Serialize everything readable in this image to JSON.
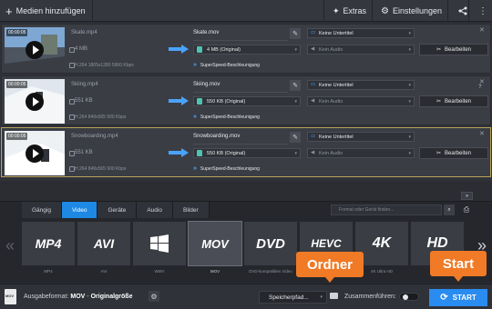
{
  "toolbar": {
    "add_media": "Medien hinzufügen",
    "extras": "Extras",
    "settings": "Einstellungen"
  },
  "files": [
    {
      "timestamp": "00:00:05",
      "source_name": "Skate.mp4",
      "source_size": "4 MB",
      "source_info": "H.264 1805x1280 5900 Kbps",
      "output_name": "Skate.mov",
      "output_size": "4 MB (Original)",
      "speed_label": "SuperSpeed-Beschleunigung",
      "subtitles": "Keine Untertitel",
      "audio": "Kein Audio",
      "edit_label": "Bearbeiten"
    },
    {
      "timestamp": "00:00:05",
      "source_name": "Skiing.mp4",
      "source_size": "551 KB",
      "source_info": "H.264 849x565 900 Kbps",
      "output_name": "Skiing.mov",
      "output_size": "550 KB (Original)",
      "speed_label": "SuperSpeed-Beschleunigung",
      "subtitles": "Keine Untertitel",
      "audio": "Kein Audio",
      "edit_label": "Bearbeiten"
    },
    {
      "timestamp": "00:00:05",
      "source_name": "Snowboarding.mp4",
      "source_size": "551 KB",
      "source_info": "H.264 849x565 900 Kbps",
      "output_name": "Snowboarding.mov",
      "output_size": "550 KB (Original)",
      "speed_label": "SuperSpeed-Beschleunigung",
      "subtitles": "Keine Untertitel",
      "audio": "Kein Audio",
      "edit_label": "Bearbeiten"
    }
  ],
  "tabs": [
    "Gängig",
    "Video",
    "Geräte",
    "Audio",
    "Bilder"
  ],
  "active_tab": "Video",
  "search": {
    "placeholder": "Format oder Gerät finden..."
  },
  "formats": [
    {
      "tile": "MP4",
      "label": "MP4"
    },
    {
      "tile": "AVI",
      "label": "AVI"
    },
    {
      "tile": "WMV",
      "label": "WMV"
    },
    {
      "tile": "MOV",
      "label": "MOV"
    },
    {
      "tile": "DVD",
      "label": "DVD-kompatibles Video"
    },
    {
      "tile": "HEVC",
      "label": "HEVC"
    },
    {
      "tile": "4K",
      "label": "4K Ultra HD"
    },
    {
      "tile": "HD",
      "label": "HD"
    }
  ],
  "selected_format": "MOV",
  "bottom": {
    "output_label": "Ausgabeformat:",
    "output_format": "MOV",
    "output_quality": "Originalgröße",
    "save_path": "Speicherpfad...",
    "merge_label": "Zusammenführen:",
    "start_label": "START",
    "doc_icon_text": "MOV"
  },
  "callouts": {
    "folder": "Ordner",
    "start": "Start"
  },
  "colors": {
    "accent": "#2a8cf0",
    "callout": "#f07a26",
    "active_border": "#b9a45a",
    "file_icon": "#4fc3b0"
  }
}
